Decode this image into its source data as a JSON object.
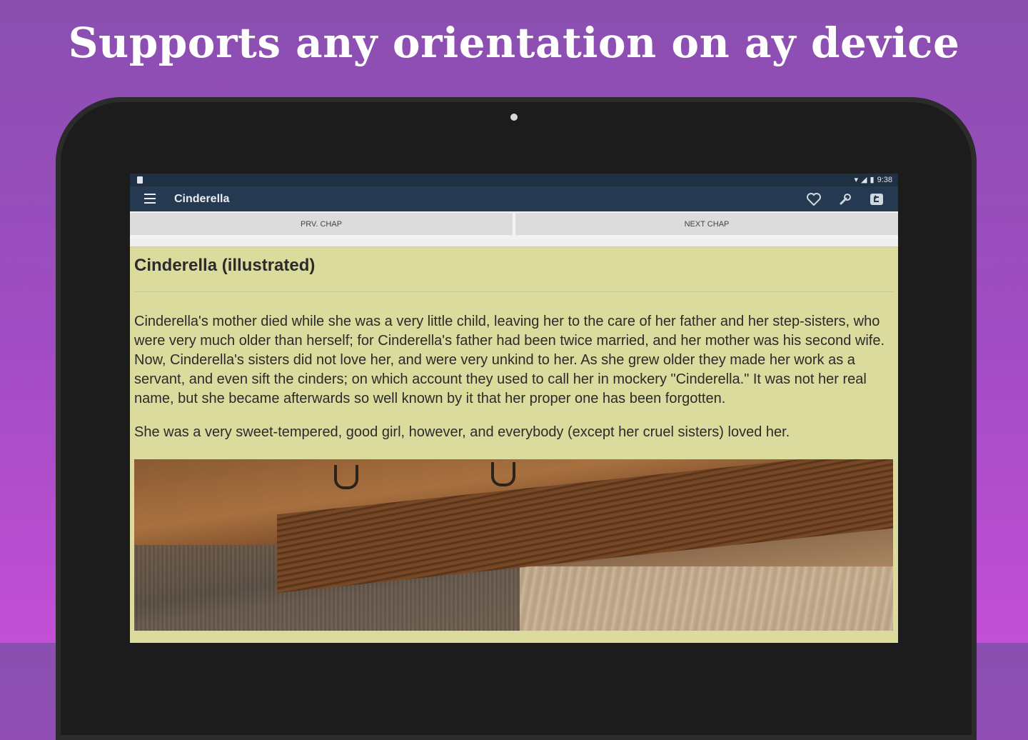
{
  "headline": "Supports any orientation on ay device",
  "status_bar": {
    "time": "9:38"
  },
  "app_bar": {
    "title": "Cinderella",
    "menu_icon": "hamburger-menu-icon",
    "actions": [
      "favorite-heart-icon",
      "wrench-settings-icon",
      "exit-icon"
    ]
  },
  "chapter_nav": {
    "prev_label": "PRV. CHAP",
    "next_label": "NEXT CHAP"
  },
  "content": {
    "title": "Cinderella (illustrated)",
    "paragraphs": [
      "Cinderella's mother died while she was a very little child, leaving her to the care of her father and her step-sisters, who were very much older than herself; for Cinderella's father had been twice married, and her mother was his second wife. Now, Cinderella's sisters did not love her, and were very unkind to her. As she grew older they made her work as a servant, and even sift the cinders; on which account they used to call her in mockery \"Cinderella.\" It was not her real name, but she became afterwards so well known by it that her proper one has been forgotten.",
      "She was a very sweet-tempered, good girl, however, and everybody (except her cruel sisters) loved her."
    ]
  },
  "colors": {
    "background_top": "#8a4fb0",
    "background_bottom": "#c34fd6",
    "app_bar": "#253a51",
    "status_bar": "#1f3043",
    "reading_background": "#dadb9d"
  }
}
